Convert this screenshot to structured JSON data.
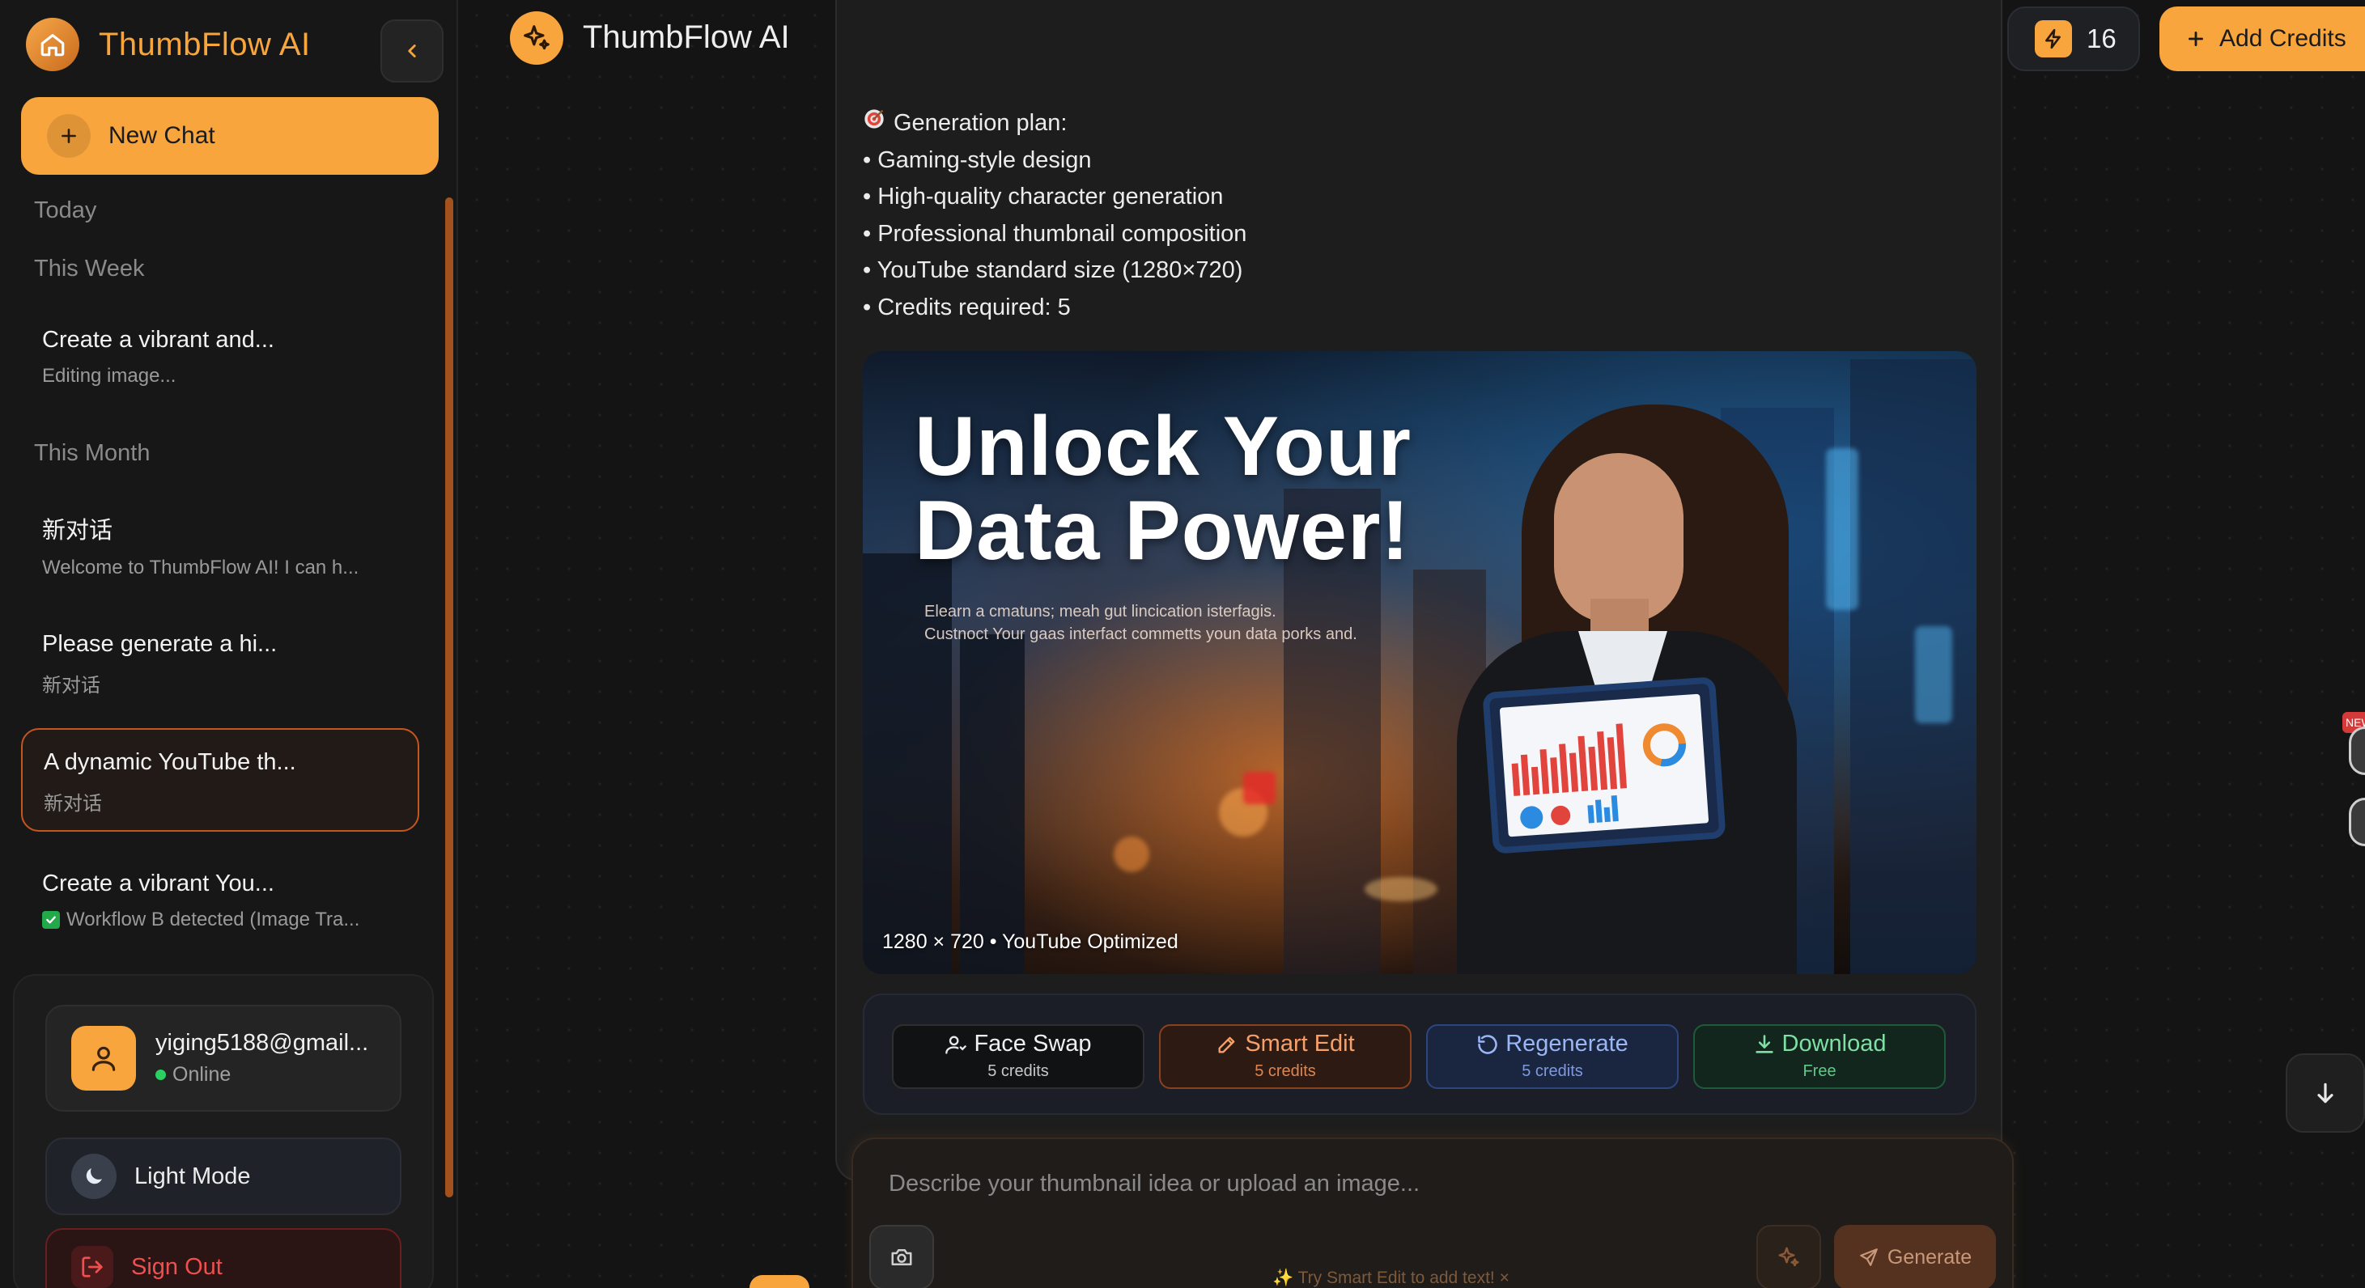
{
  "sidebar": {
    "brand": "ThumbFlow AI",
    "new_chat_label": "New Chat",
    "sections": {
      "today": "Today",
      "this_week": "This Week",
      "this_month": "This Month"
    },
    "history": [
      {
        "title": "Create a vibrant and...",
        "subtitle": "Editing image...",
        "active": false
      },
      {
        "title": "新对话",
        "subtitle": "Welcome to ThumbFlow AI! I can h...",
        "active": false
      },
      {
        "title": "Please generate a hi...",
        "subtitle": "新对话",
        "active": false
      },
      {
        "title": "A dynamic YouTube th...",
        "subtitle": "新对话",
        "active": true
      },
      {
        "title": "Create a vibrant You...",
        "subtitle": "Workflow B detected (Image Tra...",
        "active": false
      }
    ],
    "user": {
      "email": "yiging5188@gmail...",
      "status": "Online"
    },
    "mode_label": "Light Mode",
    "signout_label": "Sign Out"
  },
  "header": {
    "title": "ThumbFlow AI",
    "credits": "16",
    "add_credits_label": "Add Credits"
  },
  "message": {
    "plan_heading": "Generation plan:",
    "plan_items": [
      "• Gaming-style design",
      "• High-quality character generation",
      "• Professional thumbnail composition",
      "• YouTube standard size (1280×720)",
      "• Credits required: 5"
    ],
    "thumbnail": {
      "headline_line1": "Unlock Your",
      "headline_line2": "Data Power!",
      "sub_line1": "Elearn a cmatuns; meah gut lincication isterfagis.",
      "sub_line2": "Custnoct Your gaas interfact commetts youn data porks and.",
      "caption": "1280 × 720 • YouTube Optimized"
    },
    "actions": [
      {
        "label": "Face Swap",
        "sub": "5 credits"
      },
      {
        "label": "Smart Edit",
        "sub": "5 credits"
      },
      {
        "label": "Regenerate",
        "sub": "5 credits"
      },
      {
        "label": "Download",
        "sub": "Free"
      }
    ]
  },
  "composer": {
    "placeholder": "Describe your thumbnail idea or upload an image...",
    "generate_label": "Generate",
    "tip": "✨ Try Smart Edit to add text! ×"
  },
  "peek_badge": "NEW",
  "colors": {
    "accent": "#f8a53d",
    "background": "#141414",
    "active_border": "#c4561f",
    "online": "#2bd062",
    "danger": "#ef4f4f"
  }
}
